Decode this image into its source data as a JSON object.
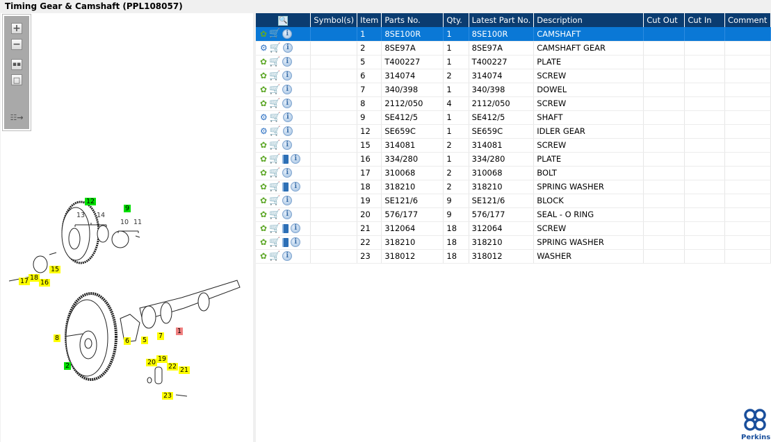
{
  "window": {
    "title": "Timing Gear & Camshaft (PPL108057)"
  },
  "toolbar": {
    "icons": [
      "zoom-in-icon",
      "zoom-out-icon",
      "fit-all-icon",
      "fit-window-icon",
      "export-icon"
    ]
  },
  "diagram": {
    "callouts": [
      {
        "label": "12",
        "color": "#00e000"
      },
      {
        "label": "9",
        "color": "#00e000"
      },
      {
        "label": "13",
        "color": ""
      },
      {
        "label": "14",
        "color": ""
      },
      {
        "label": "10",
        "color": ""
      },
      {
        "label": "11",
        "color": ""
      },
      {
        "label": "15",
        "color": "#ffff00"
      },
      {
        "label": "17",
        "color": "#ffff00"
      },
      {
        "label": "18",
        "color": "#ffff00"
      },
      {
        "label": "16",
        "color": "#ffff00"
      },
      {
        "label": "1",
        "color": "#f08080"
      },
      {
        "label": "7",
        "color": "#ffff00"
      },
      {
        "label": "8",
        "color": "#ffff00"
      },
      {
        "label": "6",
        "color": "#ffff00"
      },
      {
        "label": "5",
        "color": "#ffff00"
      },
      {
        "label": "2",
        "color": "#00e000"
      },
      {
        "label": "20",
        "color": "#ffff00"
      },
      {
        "label": "19",
        "color": "#ffff00"
      },
      {
        "label": "22",
        "color": "#ffff00"
      },
      {
        "label": "21",
        "color": "#ffff00"
      },
      {
        "label": "23",
        "color": "#ffff00"
      }
    ]
  },
  "table": {
    "columns": [
      "",
      "Symbol(s)",
      "Item",
      "Parts No.",
      "Qty.",
      "Latest Part No.",
      "Description",
      "Cut Out",
      "Cut In",
      "Comment"
    ],
    "rows": [
      {
        "item": "1",
        "part": "8SE100R",
        "qty": "1",
        "latest": "8SE100R",
        "desc": "CAMSHAFT",
        "multi": false,
        "doc": false,
        "selected": true
      },
      {
        "item": "2",
        "part": "8SE97A",
        "qty": "1",
        "latest": "8SE97A",
        "desc": "CAMSHAFT GEAR",
        "multi": true,
        "doc": false
      },
      {
        "item": "5",
        "part": "T400227",
        "qty": "1",
        "latest": "T400227",
        "desc": "PLATE",
        "multi": false,
        "doc": false
      },
      {
        "item": "6",
        "part": "314074",
        "qty": "2",
        "latest": "314074",
        "desc": "SCREW",
        "multi": false,
        "doc": false
      },
      {
        "item": "7",
        "part": "340/398",
        "qty": "1",
        "latest": "340/398",
        "desc": "DOWEL",
        "multi": false,
        "doc": false
      },
      {
        "item": "8",
        "part": "2112/050",
        "qty": "4",
        "latest": "2112/050",
        "desc": "SCREW",
        "multi": false,
        "doc": false
      },
      {
        "item": "9",
        "part": "SE412/5",
        "qty": "1",
        "latest": "SE412/5",
        "desc": "SHAFT",
        "multi": true,
        "doc": false
      },
      {
        "item": "12",
        "part": "SE659C",
        "qty": "1",
        "latest": "SE659C",
        "desc": "IDLER GEAR",
        "multi": true,
        "doc": false
      },
      {
        "item": "15",
        "part": "314081",
        "qty": "2",
        "latest": "314081",
        "desc": "SCREW",
        "multi": false,
        "doc": false
      },
      {
        "item": "16",
        "part": "334/280",
        "qty": "1",
        "latest": "334/280",
        "desc": "PLATE",
        "multi": false,
        "doc": true
      },
      {
        "item": "17",
        "part": "310068",
        "qty": "2",
        "latest": "310068",
        "desc": "BOLT",
        "multi": false,
        "doc": false
      },
      {
        "item": "18",
        "part": "318210",
        "qty": "2",
        "latest": "318210",
        "desc": "SPRING WASHER",
        "multi": false,
        "doc": true
      },
      {
        "item": "19",
        "part": "SE121/6",
        "qty": "9",
        "latest": "SE121/6",
        "desc": "BLOCK",
        "multi": false,
        "doc": false
      },
      {
        "item": "20",
        "part": "576/177",
        "qty": "9",
        "latest": "576/177",
        "desc": "SEAL - O RING",
        "multi": false,
        "doc": false
      },
      {
        "item": "21",
        "part": "312064",
        "qty": "18",
        "latest": "312064",
        "desc": "SCREW",
        "multi": false,
        "doc": true
      },
      {
        "item": "22",
        "part": "318210",
        "qty": "18",
        "latest": "318210",
        "desc": "SPRING WASHER",
        "multi": false,
        "doc": true
      },
      {
        "item": "23",
        "part": "318012",
        "qty": "18",
        "latest": "318012",
        "desc": "WASHER",
        "multi": false,
        "doc": false
      }
    ]
  },
  "brand": {
    "name": "Perkins",
    "color": "#1a4f9c"
  },
  "colors": {
    "header": "#0b3c70",
    "selected": "#0a78d6"
  }
}
